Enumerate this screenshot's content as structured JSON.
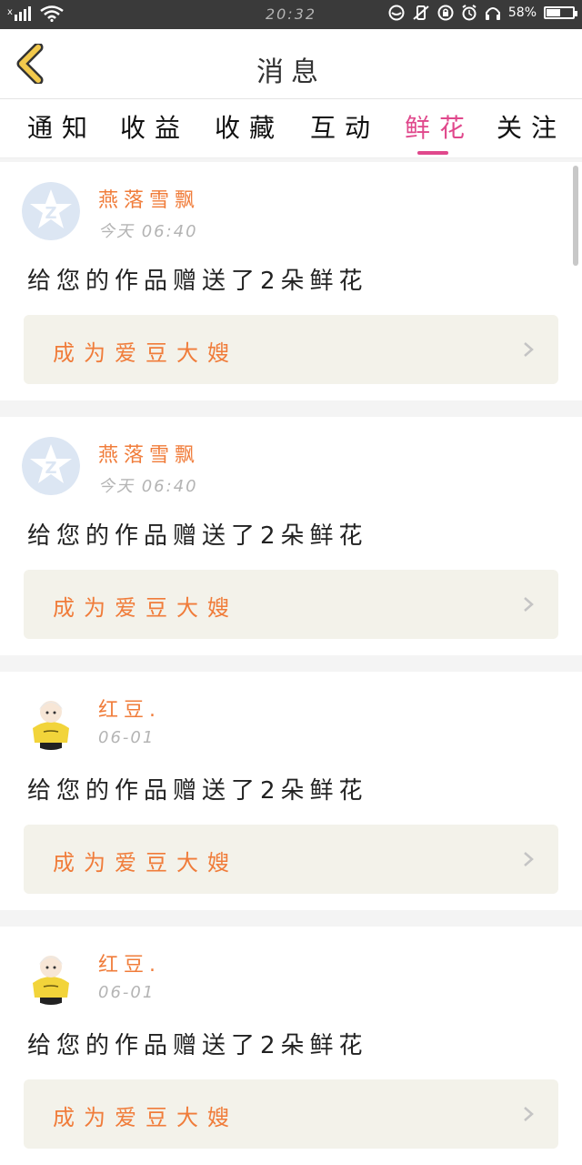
{
  "status_bar": {
    "time": "20:32",
    "battery": "58%",
    "battery_level": 0.58
  },
  "header": {
    "title": "消息"
  },
  "tabs": [
    {
      "label": "通知"
    },
    {
      "label": "收益"
    },
    {
      "label": "收藏"
    },
    {
      "label": "互动"
    },
    {
      "label": "鲜花"
    },
    {
      "label": "关注"
    }
  ],
  "active_tab": "鲜花",
  "messages": [
    {
      "name": "燕落雪飘",
      "time": "今天 06:40",
      "text": "给您的作品赠送了2朵鲜花",
      "action": "成为爱豆大嫂",
      "avatar": "qq-default-avatar"
    },
    {
      "name": "燕落雪飘",
      "time": "今天 06:40",
      "text": "给您的作品赠送了2朵鲜花",
      "action": "成为爱豆大嫂",
      "avatar": "qq-default-avatar"
    },
    {
      "name": "红豆.",
      "time": "06-01",
      "text": "给您的作品赠送了2朵鲜花",
      "action": "成为爱豆大嫂",
      "avatar": "anime-girl-avatar"
    },
    {
      "name": "红豆.",
      "time": "06-01",
      "text": "给您的作品赠送了2朵鲜花",
      "action": "成为爱豆大嫂",
      "avatar": "anime-girl-avatar"
    }
  ],
  "colors": {
    "accent": "#e0488c",
    "name": "#f07c3a",
    "back_arrow": "#f2c94c"
  }
}
